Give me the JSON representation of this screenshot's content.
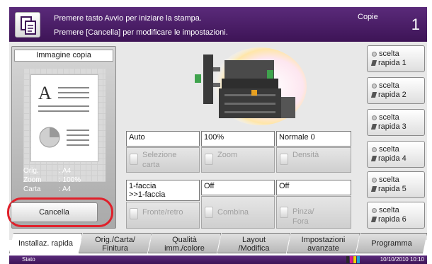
{
  "header": {
    "message_line1": "Premere tasto Avvio per iniziare la stampa.",
    "message_line2": "Premere [Cancella] per modificare le impostazioni.",
    "copies_label": "Copie",
    "copies_count": "1"
  },
  "preview": {
    "title": "Immagine copia",
    "info": [
      {
        "label": "Orig.",
        "value": ": A4"
      },
      {
        "label": "Zoom",
        "value": ": 100%"
      },
      {
        "label": "Carta",
        "value": ": A4"
      }
    ],
    "cancel_label": "Cancella"
  },
  "functions": {
    "paper_value": "Auto",
    "paper_label": "Selezione carta",
    "zoom_value": "100%",
    "zoom_label": "Zoom",
    "density_value": "Normale 0",
    "density_label": "Densità",
    "duplex_value_1": "1-faccia",
    "duplex_value_2": ">>1-faccia",
    "duplex_label": "Fronte/retro",
    "combine_value": "Off",
    "combine_label": "Combina",
    "staple_value": "Off",
    "staple_label_1": "Pinza/",
    "staple_label_2": "Fora"
  },
  "quick": [
    {
      "line1": "scelta",
      "line2": "rapida 1"
    },
    {
      "line1": "scelta",
      "line2": "rapida 2"
    },
    {
      "line1": "scelta",
      "line2": "rapida 3"
    },
    {
      "line1": "scelta",
      "line2": "rapida 4"
    },
    {
      "line1": "scelta",
      "line2": "rapida 5"
    },
    {
      "line1": "scelta",
      "line2": "rapida 6"
    }
  ],
  "tabs": [
    {
      "line1": "Installaz. rapida",
      "line2": ""
    },
    {
      "line1": "Orig./Carta/",
      "line2": "Finitura"
    },
    {
      "line1": "Qualità",
      "line2": "imm./colore"
    },
    {
      "line1": "Layout",
      "line2": "/Modifica"
    },
    {
      "line1": "Impostazioni",
      "line2": "avanzate"
    },
    {
      "line1": "Programma",
      "line2": ""
    }
  ],
  "status": {
    "label": "Stato",
    "datetime": "10/10/2010  10:10"
  },
  "colors": {
    "header_bg": "#4a1e66",
    "highlight_ring": "#e0202a",
    "toner": [
      "#2a2a2a",
      "#d81b8a",
      "#f2d400",
      "#1fa3d8"
    ]
  }
}
